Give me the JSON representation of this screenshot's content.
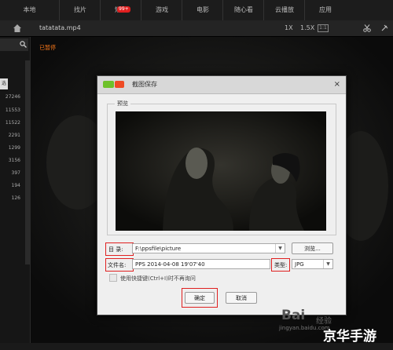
{
  "nav": {
    "tabs": [
      "本地",
      "找片",
      "短片",
      "游戏",
      "电影",
      "随心看",
      "云播放",
      "应用"
    ],
    "badge": "99+"
  },
  "player": {
    "filename": "tatatata.mp4",
    "speed_1": "1X",
    "speed_2": "1.5X",
    "box": "1:1",
    "status": "已暂停"
  },
  "sidebar": {
    "pill": "选",
    "numbers": [
      "27246",
      "11553",
      "11522",
      "2291",
      "1299",
      "3156",
      "397",
      "194",
      "126"
    ]
  },
  "dialog": {
    "title": "截图保存",
    "close": "×",
    "preview_label": "预览",
    "dir_label": "目  录:",
    "dir_value": "F:\\ppsfile\\picture",
    "browse": "浏览...",
    "filename_label": "文件名:",
    "filename_value": "PPS 2014-04-08 19'07'40",
    "type_label": "类型:",
    "type_value": "JPG",
    "checkbox_label": "使用快捷键(Ctrl+I)时不再询问",
    "ok": "确定",
    "cancel": "取消"
  },
  "watermark": {
    "line1": "Bai",
    "line2": "经验",
    "line3": "jingyan.baidu.com",
    "line4": "京华手游"
  },
  "colors": {
    "accent_red": "#e02020",
    "paused_orange": "#ff7a1a"
  }
}
